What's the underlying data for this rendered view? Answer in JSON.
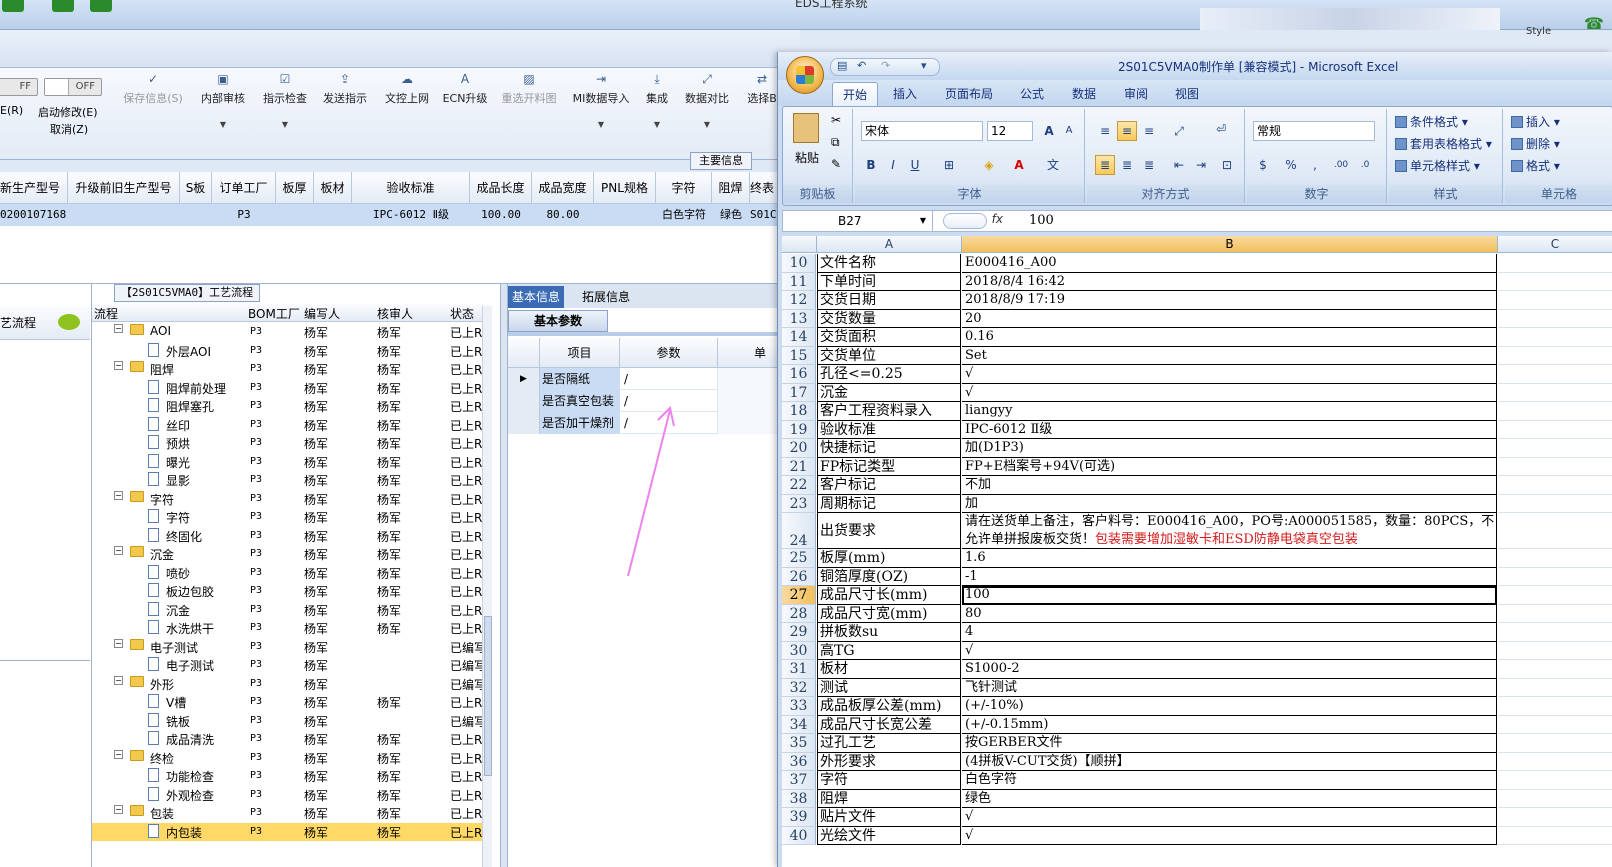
{
  "erp": {
    "window_title": "EDS工程系统",
    "style_label": "Style",
    "toolbar": {
      "off_label": "FF",
      "off2_label": "OFF",
      "left_partial1": "E(R)",
      "enable_edit": "启动修改(E)",
      "cancel": "取消(Z)",
      "buttons": [
        "保存信息(S)",
        "内部审核",
        "指示检查",
        "发送指示",
        "文控上网",
        "ECN升级",
        "重选开料图",
        "MI数据导入",
        "集成",
        "数据对比",
        "选择B"
      ]
    },
    "main_info_tab": "主要信息",
    "top_grid": {
      "headers": [
        "新生产型号",
        "升级前旧生产型号",
        "S板",
        "订单工厂",
        "板厚",
        "板材",
        "验收标准",
        "成品长度",
        "成品宽度",
        "PNL规格",
        "字符",
        "阻焊",
        "终表"
      ],
      "row": [
        "0200107168",
        "",
        "",
        "P3",
        "",
        "",
        "IPC-6012 Ⅱ级",
        "100.00",
        "80.00",
        "",
        "白色字符",
        "绿色",
        "S01C"
      ]
    },
    "left_pane_label": "艺流程",
    "tree": {
      "caption": "【2S01C5VMA0】工艺流程",
      "headers": [
        "流程",
        "BOM工厂",
        "编写人",
        "核审人",
        "状态"
      ],
      "rows": [
        {
          "level": 0,
          "name": "AOI",
          "fac": "P3",
          "w": "杨军",
          "r": "杨军",
          "s": "已上R"
        },
        {
          "level": 1,
          "name": "外层AOI",
          "fac": "P3",
          "w": "杨军",
          "r": "杨军",
          "s": "已上R"
        },
        {
          "level": 0,
          "name": "阻焊",
          "fac": "P3",
          "w": "杨军",
          "r": "杨军",
          "s": "已上R"
        },
        {
          "level": 1,
          "name": "阻焊前处理",
          "fac": "P3",
          "w": "杨军",
          "r": "杨军",
          "s": "已上R"
        },
        {
          "level": 1,
          "name": "阻焊塞孔",
          "fac": "P3",
          "w": "杨军",
          "r": "杨军",
          "s": "已上R"
        },
        {
          "level": 1,
          "name": "丝印",
          "fac": "P3",
          "w": "杨军",
          "r": "杨军",
          "s": "已上R"
        },
        {
          "level": 1,
          "name": "预烘",
          "fac": "P3",
          "w": "杨军",
          "r": "杨军",
          "s": "已上R"
        },
        {
          "level": 1,
          "name": "曝光",
          "fac": "P3",
          "w": "杨军",
          "r": "杨军",
          "s": "已上R"
        },
        {
          "level": 1,
          "name": "显影",
          "fac": "P3",
          "w": "杨军",
          "r": "杨军",
          "s": "已上R"
        },
        {
          "level": 0,
          "name": "字符",
          "fac": "P3",
          "w": "杨军",
          "r": "杨军",
          "s": "已上R"
        },
        {
          "level": 1,
          "name": "字符",
          "fac": "P3",
          "w": "杨军",
          "r": "杨军",
          "s": "已上R"
        },
        {
          "level": 1,
          "name": "终固化",
          "fac": "P3",
          "w": "杨军",
          "r": "杨军",
          "s": "已上R"
        },
        {
          "level": 0,
          "name": "沉金",
          "fac": "P3",
          "w": "杨军",
          "r": "杨军",
          "s": "已上R"
        },
        {
          "level": 1,
          "name": "喷砂",
          "fac": "P3",
          "w": "杨军",
          "r": "杨军",
          "s": "已上R"
        },
        {
          "level": 1,
          "name": "板边包胶",
          "fac": "P3",
          "w": "杨军",
          "r": "杨军",
          "s": "已上R"
        },
        {
          "level": 1,
          "name": "沉金",
          "fac": "P3",
          "w": "杨军",
          "r": "杨军",
          "s": "已上R"
        },
        {
          "level": 1,
          "name": "水洗烘干",
          "fac": "P3",
          "w": "杨军",
          "r": "杨军",
          "s": "已上R"
        },
        {
          "level": 0,
          "name": "电子测试",
          "fac": "P3",
          "w": "杨军",
          "r": "",
          "s": "已编写"
        },
        {
          "level": 1,
          "name": "电子测试",
          "fac": "P3",
          "w": "杨军",
          "r": "",
          "s": "已编写"
        },
        {
          "level": 0,
          "name": "外形",
          "fac": "P3",
          "w": "杨军",
          "r": "",
          "s": "已编写"
        },
        {
          "level": 1,
          "name": "V槽",
          "fac": "P3",
          "w": "杨军",
          "r": "杨军",
          "s": "已上R"
        },
        {
          "level": 1,
          "name": "铣板",
          "fac": "P3",
          "w": "杨军",
          "r": "",
          "s": "已编写"
        },
        {
          "level": 1,
          "name": "成品清洗",
          "fac": "P3",
          "w": "杨军",
          "r": "杨军",
          "s": "已上R"
        },
        {
          "level": 0,
          "name": "终检",
          "fac": "P3",
          "w": "杨军",
          "r": "杨军",
          "s": "已上R"
        },
        {
          "level": 1,
          "name": "功能检查",
          "fac": "P3",
          "w": "杨军",
          "r": "杨军",
          "s": "已上R"
        },
        {
          "level": 1,
          "name": "外观检查",
          "fac": "P3",
          "w": "杨军",
          "r": "杨军",
          "s": "已上R"
        },
        {
          "level": 0,
          "name": "包装",
          "fac": "P3",
          "w": "杨军",
          "r": "杨军",
          "s": "已上R"
        },
        {
          "level": 1,
          "name": "内包装",
          "fac": "P3",
          "w": "杨军",
          "r": "杨军",
          "s": "已上R",
          "selected": true
        }
      ]
    },
    "info": {
      "tabs": [
        "基本信息",
        "拓展信息"
      ],
      "subtab": "基本参数",
      "headers": [
        "项目",
        "参数",
        "单位"
      ],
      "rows": [
        {
          "item": "是否隔纸",
          "value": "/"
        },
        {
          "item": "是否真空包装",
          "value": "/"
        },
        {
          "item": "是否加干燥剂",
          "value": "/"
        }
      ]
    }
  },
  "excel": {
    "title": "2S01C5VMA0制作单 [兼容模式] - Microsoft Excel",
    "ribbon_tabs": [
      "开始",
      "插入",
      "页面布局",
      "公式",
      "数据",
      "审阅",
      "视图"
    ],
    "clipboard": {
      "paste": "粘贴",
      "group": "剪贴板"
    },
    "font": {
      "name": "宋体",
      "size": "12",
      "group": "字体"
    },
    "alignment": {
      "group": "对齐方式"
    },
    "number": {
      "format": "常规",
      "group": "数字"
    },
    "styles": {
      "cond": "条件格式",
      "table": "套用表格格式",
      "cell": "单元格样式",
      "group": "样式"
    },
    "cells": {
      "insert": "插入",
      "delete": "删除",
      "format": "格式",
      "group": "单元格"
    },
    "name_box": "B27",
    "formula": "100",
    "columns": [
      "A",
      "B",
      "C"
    ],
    "rows": [
      {
        "n": "10",
        "a": "文件名称",
        "b": "E000416_A00"
      },
      {
        "n": "11",
        "a": "下单时间",
        "b": "2018/8/4 16:42"
      },
      {
        "n": "12",
        "a": "交货日期",
        "b": "2018/8/9 17:19"
      },
      {
        "n": "13",
        "a": "交货数量",
        "b": "20"
      },
      {
        "n": "14",
        "a": "交货面积",
        "b": "0.16"
      },
      {
        "n": "15",
        "a": "交货单位",
        "b": "Set"
      },
      {
        "n": "16",
        "a": "孔径<=0.25",
        "b": "√"
      },
      {
        "n": "17",
        "a": "沉金",
        "b": "√"
      },
      {
        "n": "18",
        "a": "客户工程资料录入",
        "b": "liangyy"
      },
      {
        "n": "19",
        "a": "验收标准",
        "b": "IPC-6012 Ⅱ级"
      },
      {
        "n": "20",
        "a": "快捷标记",
        "b": "加(D1P3)"
      },
      {
        "n": "21",
        "a": "FP标记类型",
        "b": "FP+E档案号+94V(可选)"
      },
      {
        "n": "22",
        "a": "客户标记",
        "b": "不加"
      },
      {
        "n": "23",
        "a": "周期标记",
        "b": "加"
      },
      {
        "n": "24",
        "a": "出货要求",
        "b": "请在送货单上备注，客户料号：E000416_A00，PO号:A000051585，数量：80PCS，不允许单拼报废板交货！",
        "b_red": "包装需要增加湿敏卡和ESD防静电袋真空包装",
        "tall": true
      },
      {
        "n": "25",
        "a": "板厚(mm)",
        "b": "1.6"
      },
      {
        "n": "26",
        "a": "铜箔厚度(OZ)",
        "b": "-1"
      },
      {
        "n": "27",
        "a": "成品尺寸长(mm)",
        "b": "100",
        "active": true
      },
      {
        "n": "28",
        "a": "成品尺寸宽(mm)",
        "b": "80"
      },
      {
        "n": "29",
        "a": "拼板数su",
        "b": "4"
      },
      {
        "n": "30",
        "a": "高TG",
        "b": "√"
      },
      {
        "n": "31",
        "a": "板材",
        "b": "S1000-2"
      },
      {
        "n": "32",
        "a": "测试",
        "b": "飞针测试"
      },
      {
        "n": "33",
        "a": "成品板厚公差(mm)",
        "b": "(+/-10%)"
      },
      {
        "n": "34",
        "a": "成品尺寸长宽公差",
        "b": "(+/-0.15mm)"
      },
      {
        "n": "35",
        "a": "过孔工艺",
        "b": "按GERBER文件"
      },
      {
        "n": "36",
        "a": "外形要求",
        "b": "(4拼板V-CUT交货)【顺拼】"
      },
      {
        "n": "37",
        "a": "字符",
        "b": "白色字符"
      },
      {
        "n": "38",
        "a": "阻焊",
        "b": "绿色"
      },
      {
        "n": "39",
        "a": "贴片文件",
        "b": "√"
      },
      {
        "n": "40",
        "a": "光绘文件",
        "b": "√"
      }
    ]
  }
}
